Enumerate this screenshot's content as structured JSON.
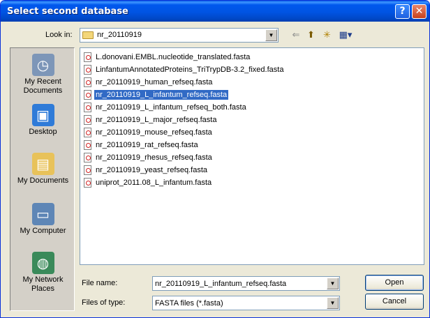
{
  "dialog": {
    "title": "Select second database",
    "help_glyph": "?",
    "close_glyph": "✕"
  },
  "lookin": {
    "label": "Look in:",
    "value": "nr_20110919"
  },
  "toolbar": {
    "back_glyph": "⇐",
    "up_glyph": "⬆",
    "new_folder_glyph": "✳",
    "view_glyph": "▦▾"
  },
  "places": [
    {
      "label": "My Recent Documents",
      "icon": "clock-document-icon"
    },
    {
      "label": "Desktop",
      "icon": "desktop-icon"
    },
    {
      "label": "My Documents",
      "icon": "folder-documents-icon"
    },
    {
      "label": "My Computer",
      "icon": "computer-icon"
    },
    {
      "label": "My Network Places",
      "icon": "network-globe-icon"
    }
  ],
  "files": [
    {
      "name": "L.donovani.EMBL.nucleotide_translated.fasta",
      "selected": false
    },
    {
      "name": "LinfantumAnnotatedProteins_TriTrypDB-3.2_fixed.fasta",
      "selected": false
    },
    {
      "name": "nr_20110919_human_refseq.fasta",
      "selected": false
    },
    {
      "name": "nr_20110919_L_infantum_refseq.fasta",
      "selected": true
    },
    {
      "name": "nr_20110919_L_infantum_refseq_both.fasta",
      "selected": false
    },
    {
      "name": "nr_20110919_L_major_refseq.fasta",
      "selected": false
    },
    {
      "name": "nr_20110919_mouse_refseq.fasta",
      "selected": false
    },
    {
      "name": "nr_20110919_rat_refseq.fasta",
      "selected": false
    },
    {
      "name": "nr_20110919_rhesus_refseq.fasta",
      "selected": false
    },
    {
      "name": "nr_20110919_yeast_refseq.fasta",
      "selected": false
    },
    {
      "name": "uniprot_2011.08_L_infantum.fasta",
      "selected": false
    }
  ],
  "file_name": {
    "label": "File name:",
    "value": "nr_20110919_L_infantum_refseq.fasta"
  },
  "file_type": {
    "label": "Files of type:",
    "value": "FASTA files (*.fasta)"
  },
  "buttons": {
    "open": "Open",
    "cancel": "Cancel"
  },
  "colors": {
    "selection": "#316ac5",
    "titlebar": "#0054e3"
  }
}
